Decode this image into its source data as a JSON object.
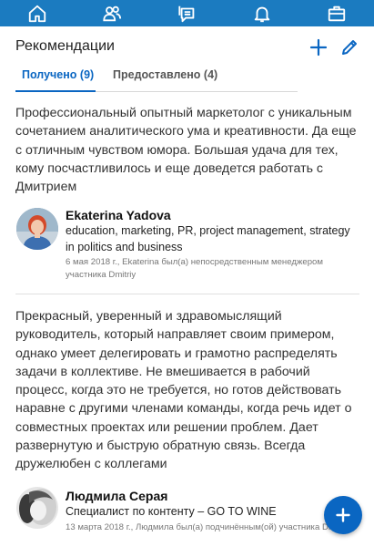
{
  "nav": {
    "tabs": [
      {
        "icon": "home-icon"
      },
      {
        "icon": "my-network-icon"
      },
      {
        "icon": "messaging-icon"
      },
      {
        "icon": "notifications-bell-icon"
      },
      {
        "icon": "jobs-briefcase-icon"
      }
    ]
  },
  "colors": {
    "brand_blue": "#1b7bc0",
    "accent_blue": "#0a66c2"
  },
  "section": {
    "title": "Рекомендации",
    "add_icon": "plus-icon",
    "edit_icon": "pencil-icon"
  },
  "tabs": {
    "received": "Получено (9)",
    "given": "Предоставлено (4)"
  },
  "recommendations": [
    {
      "text": "Профессиональный опытный маркетолог с уникальным сочетанием аналитического ума и креативности. Да еще с отличным чувством юмора. Большая удача для тех, кому посчастливилось и еще доведется работать с Дмитрием",
      "name": "Ekaterina Yadova",
      "headline": "education, marketing, PR, project management, strategy in politics and business",
      "meta": "6 мая 2018 г., Ekaterina был(а) непосредственным менеджером участника Dmitriy"
    },
    {
      "text": "Прекрасный, уверенный и здравомыслящий руководитель, который направляет своим примером, однако умеет делегировать и грамотно распределять задачи в коллективе. Не вмешивается в рабочий процесс, когда это не требуется, но готов действовать наравне с другими членами команды, когда речь идет о совместных проектах или решении проблем. Дает развернутую и быструю обратную связь. Всегда дружелюбен с коллегами",
      "name": "Людмила Серая",
      "headline": "Специалист по контенту – GO TO WINE",
      "meta": "13 марта 2018 г., Людмила был(а) подчинённым(ой) участника Dmitriy"
    }
  ],
  "fab": {
    "icon": "plus-icon"
  }
}
